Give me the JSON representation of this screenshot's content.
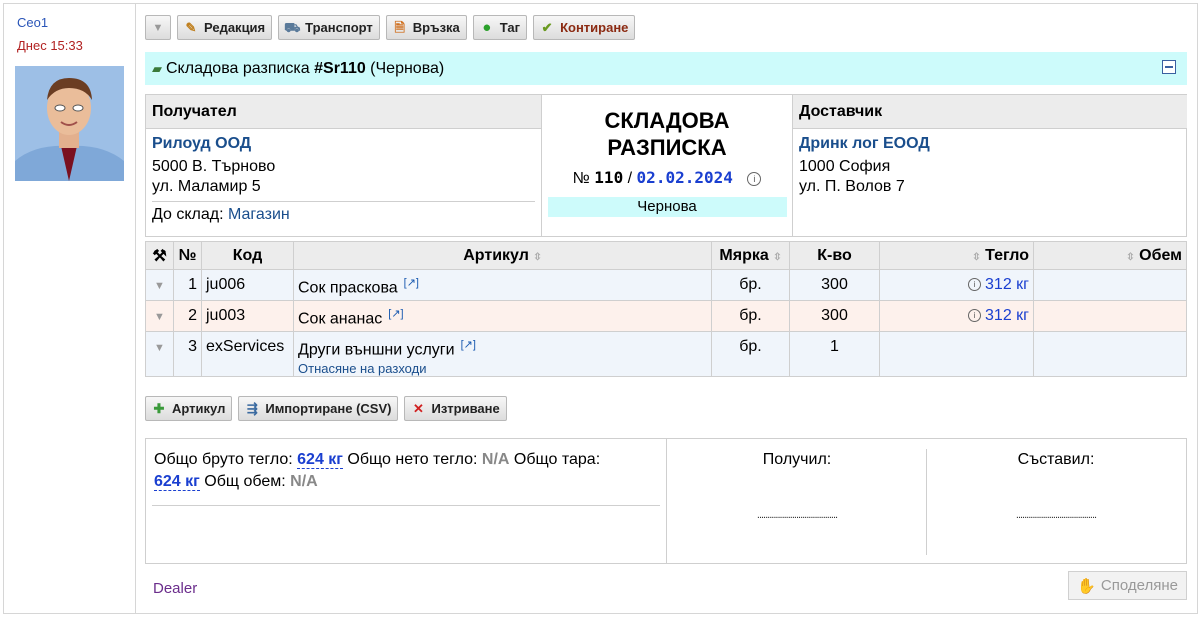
{
  "sidebar": {
    "author": "Ceo1",
    "date": "Днес 15:33"
  },
  "toolbar": {
    "buttons": [
      {
        "label": "Редакция",
        "icon": "pencil-icon"
      },
      {
        "label": "Транспорт",
        "icon": "truck-icon"
      },
      {
        "label": "Връзка",
        "icon": "document-link-icon"
      },
      {
        "label": "Таг",
        "icon": "tag-dot-icon"
      },
      {
        "label": "Контиране",
        "icon": "check-circle-icon"
      }
    ]
  },
  "doc": {
    "title_prefix": "Складова разписка ",
    "title_handle": "#Sr110",
    "title_suffix": " (Чернова)",
    "heading": "СКЛАДОВА РАЗПИСКА",
    "number_label": "№",
    "number": "110",
    "date": "02.02.2024",
    "status": "Чернова"
  },
  "recipient": {
    "header": "Получател",
    "name": "Рилоуд ООД",
    "city": "5000 В. Търново",
    "street": "ул. Маламир 5",
    "store_label": "До склад:",
    "store": "Магазин"
  },
  "supplier": {
    "header": "Доставчик",
    "name": "Дринк лог ЕООД",
    "city": "1000 София",
    "street": "ул. П. Волов 7"
  },
  "table": {
    "headers": {
      "num": "№",
      "code": "Код",
      "article": "Артикул",
      "unit": "Мярка",
      "qty": "К-во",
      "weight": "Тегло",
      "volume": "Обем"
    },
    "rows": [
      {
        "n": "1",
        "code": "ju006",
        "article": "Сок праскова",
        "sub": "",
        "unit": "бр.",
        "qty": "300",
        "weight": "312 кг",
        "volume": ""
      },
      {
        "n": "2",
        "code": "ju003",
        "article": "Сок ананас",
        "sub": "",
        "unit": "бр.",
        "qty": "300",
        "weight": "312 кг",
        "volume": ""
      },
      {
        "n": "3",
        "code": "exServices",
        "article": "Други външни услуги",
        "sub": "Отнасяне на разходи",
        "unit": "бр.",
        "qty": "1",
        "weight": "",
        "volume": ""
      }
    ]
  },
  "actions": [
    {
      "label": "Артикул"
    },
    {
      "label": "Импортиране (CSV)"
    },
    {
      "label": "Изтриване"
    }
  ],
  "totals": {
    "gross_label": "Общо бруто тегло:",
    "gross": "624 кг",
    "net_label": "Общо нето тегло:",
    "net": "N/A",
    "tare_label": "Общо тара:",
    "tare": "624 кг",
    "volume_label": "Общ обем:",
    "volume": "N/A"
  },
  "signatures": {
    "received": "Получил:",
    "composed": "Съставил:",
    "line": "......................................."
  },
  "footer": {
    "dealer": "Dealer",
    "share": "Споделяне"
  }
}
